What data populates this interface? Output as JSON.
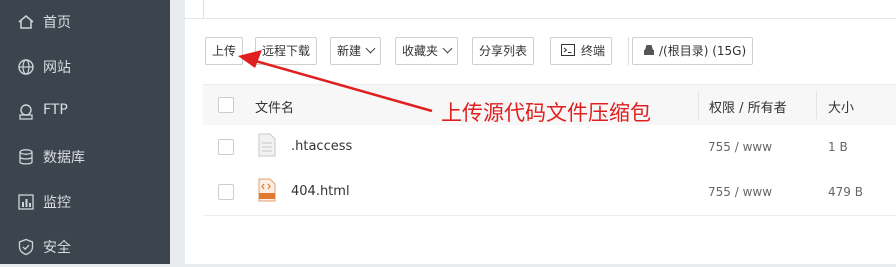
{
  "sidebar": {
    "items": [
      {
        "label": "首页",
        "icon": "home-icon"
      },
      {
        "label": "网站",
        "icon": "globe-icon"
      },
      {
        "label": "FTP",
        "icon": "ftp-icon"
      },
      {
        "label": "数据库",
        "icon": "database-icon"
      },
      {
        "label": "监控",
        "icon": "monitor-icon"
      },
      {
        "label": "安全",
        "icon": "shield-icon"
      }
    ]
  },
  "toolbar": {
    "upload": "上传",
    "remote_download": "远程下载",
    "new": "新建",
    "favorites": "收藏夹",
    "share_list": "分享列表",
    "terminal": "终端",
    "disk": "/(根目录) (15G)"
  },
  "table": {
    "headers": {
      "name": "文件名",
      "perm": "权限 / 所有者",
      "size": "大小"
    },
    "rows": [
      {
        "name": ".htaccess",
        "perm": "755 / www",
        "size": "1 B",
        "icon": "text-file-icon"
      },
      {
        "name": "404.html",
        "perm": "755 / www",
        "size": "479 B",
        "icon": "html-file-icon"
      }
    ]
  },
  "annotation": {
    "text": "上传源代码文件压缩包",
    "color": "#e02020"
  },
  "colors": {
    "sidebar_bg": "#3c444d",
    "sidebar_text": "#d9dde2",
    "annotation": "#e02020"
  }
}
